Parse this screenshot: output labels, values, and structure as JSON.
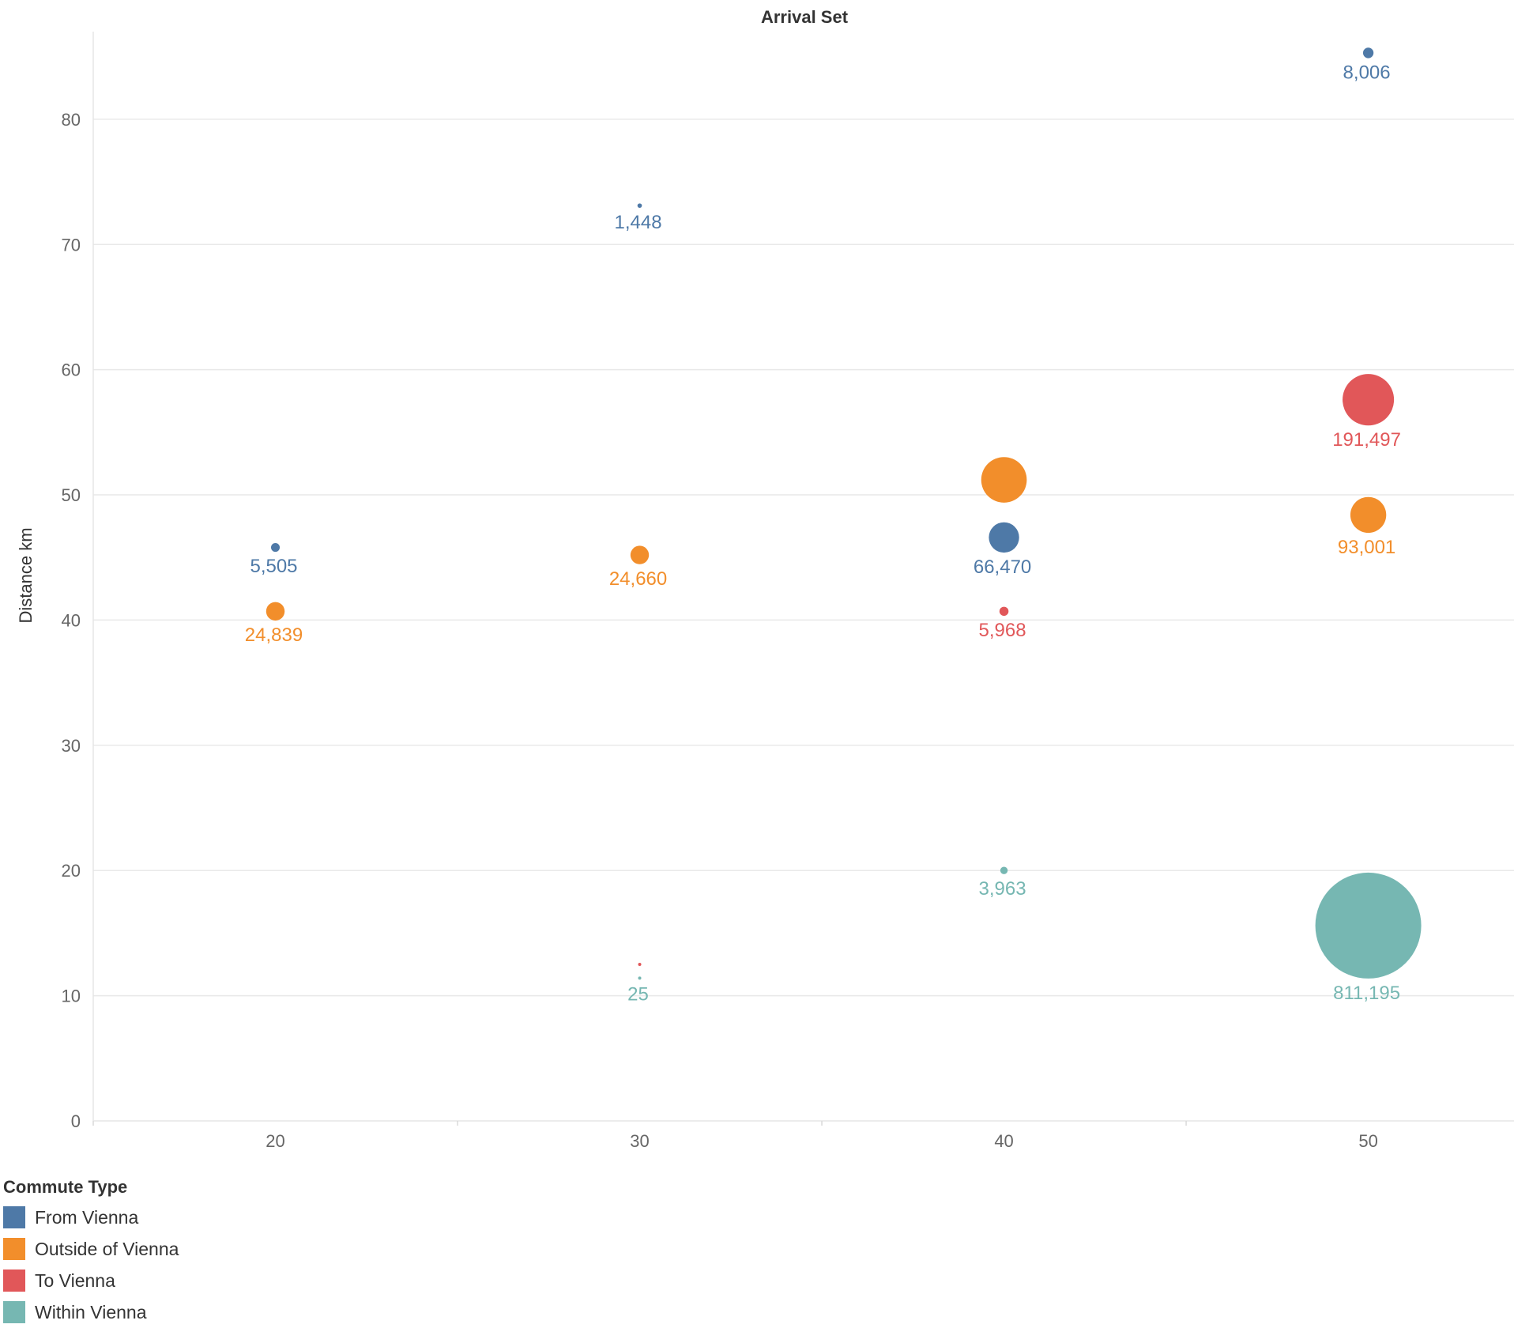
{
  "chart_data": {
    "type": "scatter",
    "title": "Arrival Set",
    "xlabel": "",
    "ylabel": "Distance km",
    "xlim": [
      15,
      54
    ],
    "ylim": [
      0,
      87
    ],
    "xticks": [
      20,
      30,
      40,
      50
    ],
    "yticks": [
      0,
      10,
      20,
      30,
      40,
      50,
      60,
      70,
      80
    ],
    "grid": true,
    "legend_title": "Commute Type",
    "legend_position": "bottom-left",
    "series": [
      {
        "name": "From Vienna",
        "color": "#4e79a7",
        "points": [
          {
            "x": 20,
            "y": 45.8,
            "size": 5505,
            "label": "5,505"
          },
          {
            "x": 30,
            "y": 73.1,
            "size": 1448,
            "label": "1,448"
          },
          {
            "x": 40,
            "y": 46.6,
            "size": 66470,
            "label": "66,470"
          },
          {
            "x": 50,
            "y": 85.3,
            "size": 8006,
            "label": "8,006"
          }
        ]
      },
      {
        "name": "Outside of Vienna",
        "color": "#f28e2b",
        "points": [
          {
            "x": 20,
            "y": 40.7,
            "size": 24839,
            "label": "24,839"
          },
          {
            "x": 30,
            "y": 45.2,
            "size": 24660,
            "label": "24,660"
          },
          {
            "x": 40,
            "y": 51.2,
            "size": 150000,
            "label": ""
          },
          {
            "x": 50,
            "y": 48.4,
            "size": 93001,
            "label": "93,001"
          }
        ]
      },
      {
        "name": "To Vienna",
        "color": "#e15759",
        "points": [
          {
            "x": 30,
            "y": 12.5,
            "size": 150,
            "label": ""
          },
          {
            "x": 40,
            "y": 40.7,
            "size": 5968,
            "label": "5,968"
          },
          {
            "x": 50,
            "y": 57.6,
            "size": 191497,
            "label": "191,497"
          }
        ]
      },
      {
        "name": "Within Vienna",
        "color": "#76b7b2",
        "points": [
          {
            "x": 30,
            "y": 11.4,
            "size": 25,
            "label": "25"
          },
          {
            "x": 40,
            "y": 20.0,
            "size": 3963,
            "label": "3,963"
          },
          {
            "x": 50,
            "y": 15.6,
            "size": 811195,
            "label": "811,195"
          }
        ]
      }
    ]
  }
}
